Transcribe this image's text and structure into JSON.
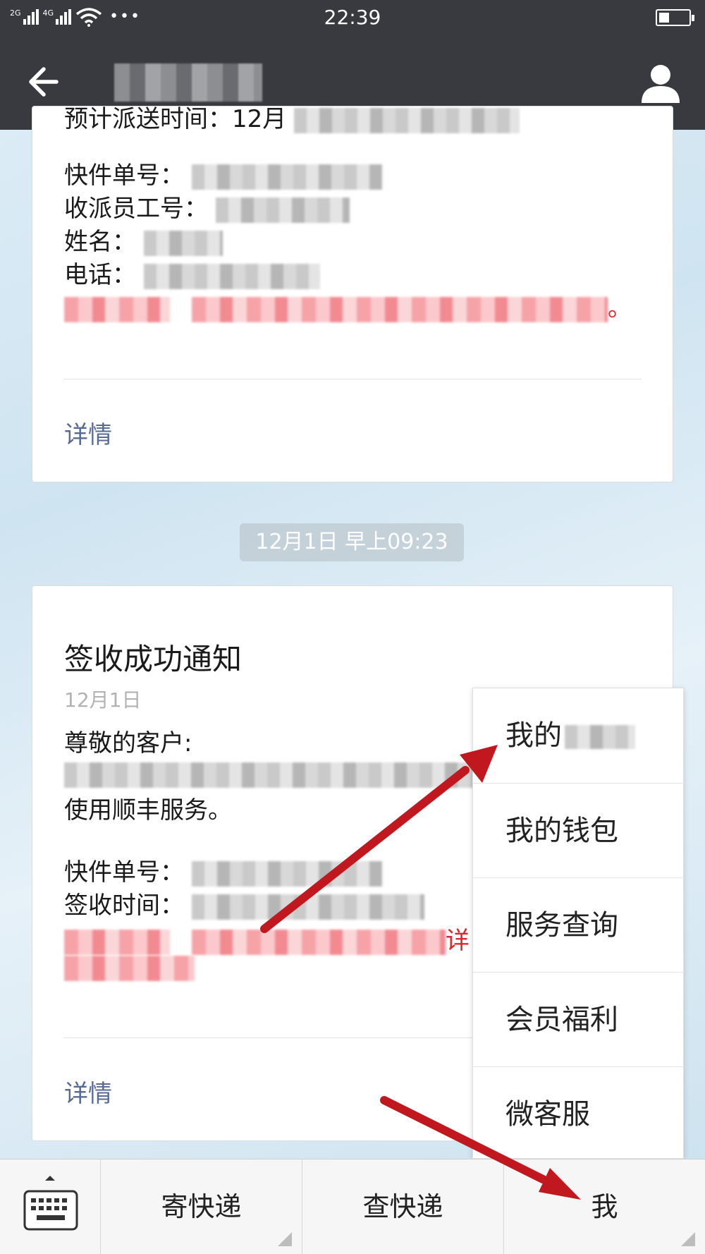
{
  "status_bar": {
    "net1": "2G",
    "net2": "4G",
    "dots": "•••",
    "time": "22:39",
    "battery_level": 0.35
  },
  "nav": {
    "back_icon": "arrow-left-icon",
    "profile_icon": "person-icon"
  },
  "card1": {
    "partial_line": "预计派送时间：12月",
    "fields": [
      {
        "label": "快件单号："
      },
      {
        "label": "收派员工号："
      },
      {
        "label": "姓名："
      },
      {
        "label": "电话："
      }
    ],
    "tail": "。",
    "detail": "详情"
  },
  "timestamp": "12月1日 早上09:23",
  "card2": {
    "title": "签收成功通知",
    "date": "12月1日",
    "greeting": "尊敬的客户:",
    "line2": "使用顺丰服务。",
    "fields": [
      {
        "label": "快件单号："
      },
      {
        "label": "签收时间："
      }
    ],
    "red_tail": "详",
    "detail": "详情"
  },
  "popup_menu": {
    "items": [
      {
        "label": "我的"
      },
      {
        "label": "我的钱包"
      },
      {
        "label": "服务查询"
      },
      {
        "label": "会员福利"
      },
      {
        "label": "微客服"
      }
    ]
  },
  "bottom_menu": {
    "keyboard_icon": "keyboard-icon",
    "items": [
      {
        "label": "寄快递"
      },
      {
        "label": "查快递"
      },
      {
        "label": "我"
      }
    ]
  },
  "colors": {
    "header_bg": "#393a3f",
    "link": "#576b95",
    "annotation_arrow": "#c0181e"
  }
}
